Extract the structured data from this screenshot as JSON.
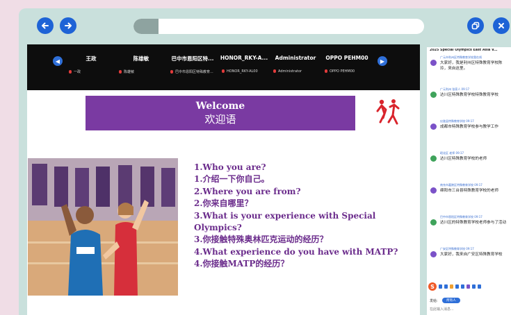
{
  "toolbar": {
    "back_icon": "arrow-left-icon",
    "forward_icon": "arrow-right-icon",
    "copy_icon": "copy-icon",
    "close_icon": "close-icon",
    "accent": "#1e63d6",
    "frame_color": "#c9e0dc",
    "page_bg": "#f0dde6"
  },
  "address": {
    "value": ""
  },
  "participants": [
    {
      "name": "王政",
      "sub": "一政"
    },
    {
      "name": "陈雄敏",
      "sub": "陈雄敏"
    },
    {
      "name": "巴中市恩阳区特...",
      "sub": "巴中市恩阳区特殊教育..."
    },
    {
      "name": "HONOR_RKY-A...",
      "sub": "HONOR_RKY-AL00"
    },
    {
      "name": "Administrator",
      "sub": "Administrator"
    },
    {
      "name": "OPPO PEHM00",
      "sub": "OPPO PEHM00"
    }
  ],
  "slide": {
    "welcome_en": "Welcome",
    "welcome_cn": "欢迎语",
    "accent": "#7a3aa2",
    "questions": [
      "1.Who you are?",
      "1.介绍一下你自己。",
      "2.Where you are from?",
      "2.你来自哪里？",
      "3.What is your experience with Special Olympics?",
      "3.你接触特殊奥林匹克运动的经历？",
      "4.What experience do you have with MATP?",
      "4.你接触MATP的经历？"
    ]
  },
  "chat": {
    "title": "2025 Special Olympics East Asia V...",
    "messages": [
      {
        "meta": "广元市利州区特殊教育学校我在线",
        "text": "大家好，我是利州区特殊教育学校陈玲，来自这里。",
        "color": "#7b52c8"
      },
      {
        "meta": "广元利州 张家人 09:17",
        "text": "达川区特殊教育学校特殊教育学校",
        "color": "#3fa35b"
      },
      {
        "meta": "仪陇县特殊教育学校 09:17",
        "text": "成都市特殊教育学校参与教学工作",
        "color": "#7b52c8"
      },
      {
        "meta": "昭化区 老师 09:17",
        "text": "达川区特殊教育学校的老师",
        "color": "#3fa35b"
      },
      {
        "meta": "南充市嘉陵区特殊教育学校 09:17",
        "text": "绵阳市三台县特殊教育学校的老师",
        "color": "#7b52c8"
      },
      {
        "meta": "巴中市恩阳区特殊教育学校 09:17",
        "text": "达川区的特殊教育学校老师参与了活动",
        "color": "#3fa35b"
      },
      {
        "meta": "广安区特殊教育学校 09:17",
        "text": "大家好，我来自广安区特殊教育学校",
        "color": "#7b52c8"
      }
    ],
    "to_label": "发给:",
    "to_value": "所有人",
    "input_placeholder": "在此输入消息..."
  }
}
